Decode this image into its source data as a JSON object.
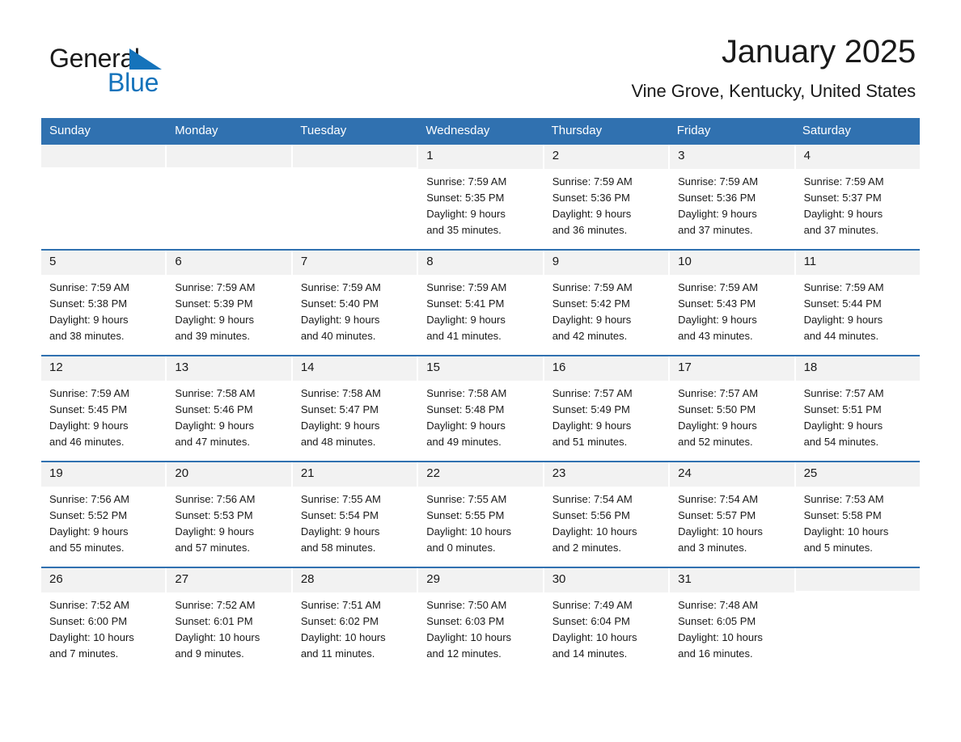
{
  "brand": {
    "name_part1": "General",
    "name_part2": "Blue",
    "triangle_color": "#1573bb"
  },
  "header": {
    "title": "January 2025",
    "subtitle": "Vine Grove, Kentucky, United States",
    "accent_color": "#3071b0",
    "daynum_band_color": "#f2f2f2"
  },
  "columns": [
    "Sunday",
    "Monday",
    "Tuesday",
    "Wednesday",
    "Thursday",
    "Friday",
    "Saturday"
  ],
  "weeks": [
    [
      {
        "day": "",
        "sunrise": "",
        "sunset": "",
        "daylight1": "",
        "daylight2": ""
      },
      {
        "day": "",
        "sunrise": "",
        "sunset": "",
        "daylight1": "",
        "daylight2": ""
      },
      {
        "day": "",
        "sunrise": "",
        "sunset": "",
        "daylight1": "",
        "daylight2": ""
      },
      {
        "day": "1",
        "sunrise": "Sunrise: 7:59 AM",
        "sunset": "Sunset: 5:35 PM",
        "daylight1": "Daylight: 9 hours",
        "daylight2": "and 35 minutes."
      },
      {
        "day": "2",
        "sunrise": "Sunrise: 7:59 AM",
        "sunset": "Sunset: 5:36 PM",
        "daylight1": "Daylight: 9 hours",
        "daylight2": "and 36 minutes."
      },
      {
        "day": "3",
        "sunrise": "Sunrise: 7:59 AM",
        "sunset": "Sunset: 5:36 PM",
        "daylight1": "Daylight: 9 hours",
        "daylight2": "and 37 minutes."
      },
      {
        "day": "4",
        "sunrise": "Sunrise: 7:59 AM",
        "sunset": "Sunset: 5:37 PM",
        "daylight1": "Daylight: 9 hours",
        "daylight2": "and 37 minutes."
      }
    ],
    [
      {
        "day": "5",
        "sunrise": "Sunrise: 7:59 AM",
        "sunset": "Sunset: 5:38 PM",
        "daylight1": "Daylight: 9 hours",
        "daylight2": "and 38 minutes."
      },
      {
        "day": "6",
        "sunrise": "Sunrise: 7:59 AM",
        "sunset": "Sunset: 5:39 PM",
        "daylight1": "Daylight: 9 hours",
        "daylight2": "and 39 minutes."
      },
      {
        "day": "7",
        "sunrise": "Sunrise: 7:59 AM",
        "sunset": "Sunset: 5:40 PM",
        "daylight1": "Daylight: 9 hours",
        "daylight2": "and 40 minutes."
      },
      {
        "day": "8",
        "sunrise": "Sunrise: 7:59 AM",
        "sunset": "Sunset: 5:41 PM",
        "daylight1": "Daylight: 9 hours",
        "daylight2": "and 41 minutes."
      },
      {
        "day": "9",
        "sunrise": "Sunrise: 7:59 AM",
        "sunset": "Sunset: 5:42 PM",
        "daylight1": "Daylight: 9 hours",
        "daylight2": "and 42 minutes."
      },
      {
        "day": "10",
        "sunrise": "Sunrise: 7:59 AM",
        "sunset": "Sunset: 5:43 PM",
        "daylight1": "Daylight: 9 hours",
        "daylight2": "and 43 minutes."
      },
      {
        "day": "11",
        "sunrise": "Sunrise: 7:59 AM",
        "sunset": "Sunset: 5:44 PM",
        "daylight1": "Daylight: 9 hours",
        "daylight2": "and 44 minutes."
      }
    ],
    [
      {
        "day": "12",
        "sunrise": "Sunrise: 7:59 AM",
        "sunset": "Sunset: 5:45 PM",
        "daylight1": "Daylight: 9 hours",
        "daylight2": "and 46 minutes."
      },
      {
        "day": "13",
        "sunrise": "Sunrise: 7:58 AM",
        "sunset": "Sunset: 5:46 PM",
        "daylight1": "Daylight: 9 hours",
        "daylight2": "and 47 minutes."
      },
      {
        "day": "14",
        "sunrise": "Sunrise: 7:58 AM",
        "sunset": "Sunset: 5:47 PM",
        "daylight1": "Daylight: 9 hours",
        "daylight2": "and 48 minutes."
      },
      {
        "day": "15",
        "sunrise": "Sunrise: 7:58 AM",
        "sunset": "Sunset: 5:48 PM",
        "daylight1": "Daylight: 9 hours",
        "daylight2": "and 49 minutes."
      },
      {
        "day": "16",
        "sunrise": "Sunrise: 7:57 AM",
        "sunset": "Sunset: 5:49 PM",
        "daylight1": "Daylight: 9 hours",
        "daylight2": "and 51 minutes."
      },
      {
        "day": "17",
        "sunrise": "Sunrise: 7:57 AM",
        "sunset": "Sunset: 5:50 PM",
        "daylight1": "Daylight: 9 hours",
        "daylight2": "and 52 minutes."
      },
      {
        "day": "18",
        "sunrise": "Sunrise: 7:57 AM",
        "sunset": "Sunset: 5:51 PM",
        "daylight1": "Daylight: 9 hours",
        "daylight2": "and 54 minutes."
      }
    ],
    [
      {
        "day": "19",
        "sunrise": "Sunrise: 7:56 AM",
        "sunset": "Sunset: 5:52 PM",
        "daylight1": "Daylight: 9 hours",
        "daylight2": "and 55 minutes."
      },
      {
        "day": "20",
        "sunrise": "Sunrise: 7:56 AM",
        "sunset": "Sunset: 5:53 PM",
        "daylight1": "Daylight: 9 hours",
        "daylight2": "and 57 minutes."
      },
      {
        "day": "21",
        "sunrise": "Sunrise: 7:55 AM",
        "sunset": "Sunset: 5:54 PM",
        "daylight1": "Daylight: 9 hours",
        "daylight2": "and 58 minutes."
      },
      {
        "day": "22",
        "sunrise": "Sunrise: 7:55 AM",
        "sunset": "Sunset: 5:55 PM",
        "daylight1": "Daylight: 10 hours",
        "daylight2": "and 0 minutes."
      },
      {
        "day": "23",
        "sunrise": "Sunrise: 7:54 AM",
        "sunset": "Sunset: 5:56 PM",
        "daylight1": "Daylight: 10 hours",
        "daylight2": "and 2 minutes."
      },
      {
        "day": "24",
        "sunrise": "Sunrise: 7:54 AM",
        "sunset": "Sunset: 5:57 PM",
        "daylight1": "Daylight: 10 hours",
        "daylight2": "and 3 minutes."
      },
      {
        "day": "25",
        "sunrise": "Sunrise: 7:53 AM",
        "sunset": "Sunset: 5:58 PM",
        "daylight1": "Daylight: 10 hours",
        "daylight2": "and 5 minutes."
      }
    ],
    [
      {
        "day": "26",
        "sunrise": "Sunrise: 7:52 AM",
        "sunset": "Sunset: 6:00 PM",
        "daylight1": "Daylight: 10 hours",
        "daylight2": "and 7 minutes."
      },
      {
        "day": "27",
        "sunrise": "Sunrise: 7:52 AM",
        "sunset": "Sunset: 6:01 PM",
        "daylight1": "Daylight: 10 hours",
        "daylight2": "and 9 minutes."
      },
      {
        "day": "28",
        "sunrise": "Sunrise: 7:51 AM",
        "sunset": "Sunset: 6:02 PM",
        "daylight1": "Daylight: 10 hours",
        "daylight2": "and 11 minutes."
      },
      {
        "day": "29",
        "sunrise": "Sunrise: 7:50 AM",
        "sunset": "Sunset: 6:03 PM",
        "daylight1": "Daylight: 10 hours",
        "daylight2": "and 12 minutes."
      },
      {
        "day": "30",
        "sunrise": "Sunrise: 7:49 AM",
        "sunset": "Sunset: 6:04 PM",
        "daylight1": "Daylight: 10 hours",
        "daylight2": "and 14 minutes."
      },
      {
        "day": "31",
        "sunrise": "Sunrise: 7:48 AM",
        "sunset": "Sunset: 6:05 PM",
        "daylight1": "Daylight: 10 hours",
        "daylight2": "and 16 minutes."
      },
      {
        "day": "",
        "sunrise": "",
        "sunset": "",
        "daylight1": "",
        "daylight2": ""
      }
    ]
  ]
}
